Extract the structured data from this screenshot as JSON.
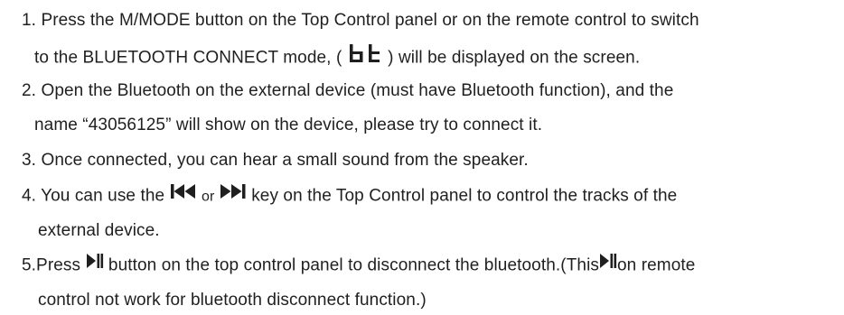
{
  "items": [
    {
      "num": "1.",
      "line1": "Press the M/MODE button on the Top Control panel or on the remote control to switch",
      "line2_before": "to the BLUETOOTH CONNECT mode, (",
      "display_icon": "bt-segment-display-icon",
      "line2_after": ") will be displayed on the screen."
    },
    {
      "num": "2.",
      "line1": "Open the Bluetooth on the external device (must have Bluetooth function), and the",
      "line2": "name “43056125” will show on the device, please try to connect it."
    },
    {
      "num": "3.",
      "line1": "Once connected, you can hear a small sound from the speaker."
    },
    {
      "num": "4.",
      "line1_before": "You can use the",
      "prev_icon": "previous-track-icon",
      "or_text": "or",
      "next_icon": "next-track-icon",
      "line1_after": "key on the Top Control panel to control the tracks of the",
      "line2": "external device."
    },
    {
      "num": "5.",
      "line1_before": "Press",
      "play_icon": "play-pause-icon",
      "line1_mid": "button on the top control panel to disconnect the bluetooth.(This",
      "play_icon_2": "play-pause-icon",
      "line1_after": "on remote",
      "line2": "control not work for bluetooth disconnect function.)"
    }
  ],
  "colors": {
    "text": "#1f1f1f"
  }
}
